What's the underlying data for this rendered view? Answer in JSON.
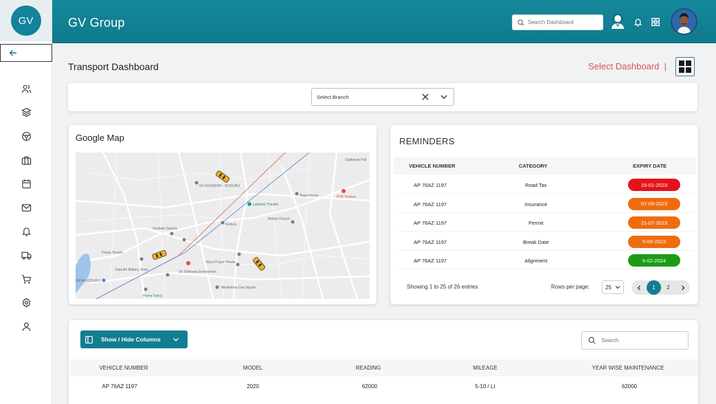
{
  "sidebar": {
    "logo_text": "GV",
    "items": [
      {
        "icon": "users-icon"
      },
      {
        "icon": "layers-icon"
      },
      {
        "icon": "steering-wheel-icon"
      },
      {
        "icon": "briefcase-icon"
      },
      {
        "icon": "calendar-icon"
      },
      {
        "icon": "mail-icon"
      },
      {
        "icon": "bell-icon"
      },
      {
        "icon": "truck-icon"
      },
      {
        "icon": "cart-icon"
      },
      {
        "icon": "settings-icon"
      },
      {
        "icon": "user-icon"
      }
    ]
  },
  "header": {
    "title": "GV Group",
    "search_placeholder": "Search Dashboard"
  },
  "page": {
    "title": "Transport Dashboard",
    "select_dashboard": "Select Dashboard",
    "separator": "|"
  },
  "branch": {
    "placeholder": "Select Branch"
  },
  "map": {
    "title": "Google Map",
    "labels": [
      "Subbarao Puli",
      "GV ACADEMY - KODURU",
      "Lakshmi Theatre",
      "PHC Koduru",
      "Alapa house",
      "Koduru",
      "Bethel Church",
      "Venkata Swamy",
      "Durga Temple",
      "Nizsi Prayer House",
      "Sri Srinivasa Enterprises",
      "Hanuthi Battery Store",
      "INDIA KODURU",
      "Hema Fancy",
      "Medhirtme Gen Niyam"
    ]
  },
  "reminders": {
    "title": "REMINDERS",
    "columns": [
      "VEHICLE NUMBER",
      "CATEGORY",
      "EXPIRY DATE"
    ],
    "rows": [
      {
        "vehicle": "AP 76AZ 1197",
        "category": "Road Tax",
        "expiry": "15-01-2023",
        "color": "#e5121b"
      },
      {
        "vehicle": "AP 76AZ 1197",
        "category": "Insurance",
        "expiry": "07-05-2023",
        "color": "#ef6c0e"
      },
      {
        "vehicle": "AP 76AZ 1197",
        "category": "Permit",
        "expiry": "21-07-2023",
        "color": "#ef6c0e"
      },
      {
        "vehicle": "AP 76AZ 1197",
        "category": "Break Date",
        "expiry": "5-09-2023",
        "color": "#ef6c0e"
      },
      {
        "vehicle": "AP 76AZ 1197",
        "category": "Alignment",
        "expiry": "5-02-2024",
        "color": "#1c9b17"
      }
    ],
    "footer": "Showing 1 to 25 of 26 entries",
    "rows_per_page_label": "Rows per page:",
    "rows_per_page": "25",
    "pages": [
      "1",
      "2"
    ],
    "current_page": "1"
  },
  "table": {
    "show_hide_label": "Show / Hide Columns",
    "search_placeholder": "Search",
    "columns": [
      "VEHICLE NUMBER",
      "MODEL",
      "READING",
      "MILEAGE",
      "YEAR WISE MAINTENANCE"
    ],
    "rows": [
      {
        "vehicle": "AP 76AZ 1197",
        "model": "2020",
        "reading": "62000",
        "mileage": "5-10 / Lt",
        "maintenance": "62000"
      }
    ]
  },
  "colors": {
    "primary": "#137d92",
    "accent_red": "#d9534f"
  }
}
